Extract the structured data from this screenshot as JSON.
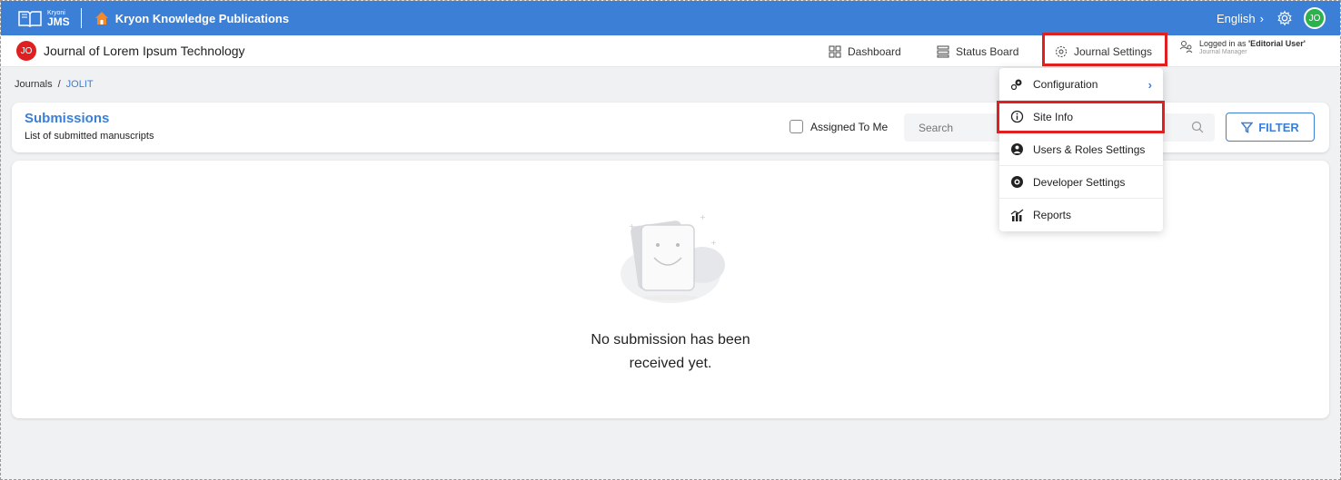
{
  "topbar": {
    "logo_small": "Kryoni",
    "logo_big": "JMS",
    "publisher": "Kryon Knowledge Publications",
    "language": "English",
    "user_initials": "JO"
  },
  "journalbar": {
    "journal_initials": "JO",
    "journal_title": "Journal of Lorem Ipsum Technology",
    "nav": {
      "dashboard": "Dashboard",
      "status_board": "Status Board",
      "journal_settings": "Journal Settings"
    },
    "logged_in_prefix": "Logged in as ",
    "logged_in_user": "'Editorial User'",
    "logged_in_role": "Journal Manager"
  },
  "breadcrumb": {
    "root": "Journals",
    "separator": "/",
    "current": "JOLIT"
  },
  "submissions": {
    "title": "Submissions",
    "subtitle": "List of submitted manuscripts",
    "assigned_label": "Assigned To Me",
    "search_placeholder": "Search",
    "filter_label": "FILTER"
  },
  "empty_state": {
    "line1": "No submission has been",
    "line2": "received yet."
  },
  "dropdown": {
    "items": [
      {
        "label": "Configuration",
        "icon": "gears-icon",
        "has_submenu": true
      },
      {
        "label": "Site Info",
        "icon": "info-icon",
        "has_submenu": false
      },
      {
        "label": "Users & Roles Settings",
        "icon": "users-roles-icon",
        "has_submenu": false
      },
      {
        "label": "Developer Settings",
        "icon": "developer-icon",
        "has_submenu": false
      },
      {
        "label": "Reports",
        "icon": "reports-icon",
        "has_submenu": false
      }
    ]
  },
  "colors": {
    "brand_blue": "#3b7fd6",
    "highlight_red": "#e02020",
    "avatar_green": "#2ab34c"
  }
}
